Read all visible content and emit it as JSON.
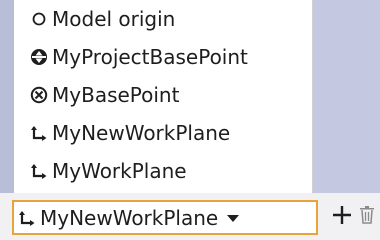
{
  "dropdown": {
    "items": [
      {
        "label": "Model origin",
        "icon": "model-origin-icon"
      },
      {
        "label": "MyProjectBasePoint",
        "icon": "project-base-point-icon"
      },
      {
        "label": "MyBasePoint",
        "icon": "base-point-icon"
      },
      {
        "label": "MyNewWorkPlane",
        "icon": "work-plane-icon"
      },
      {
        "label": "MyWorkPlane",
        "icon": "work-plane-icon"
      }
    ]
  },
  "combo": {
    "selected": "MyNewWorkPlane",
    "icon": "work-plane-icon",
    "caret_icon": "caret-down-icon"
  },
  "toolbar": {
    "add_icon": "plus-icon",
    "delete_icon": "trash-icon"
  },
  "colors": {
    "focus_border": "#e8a33a",
    "background": "#c4c8e0"
  }
}
